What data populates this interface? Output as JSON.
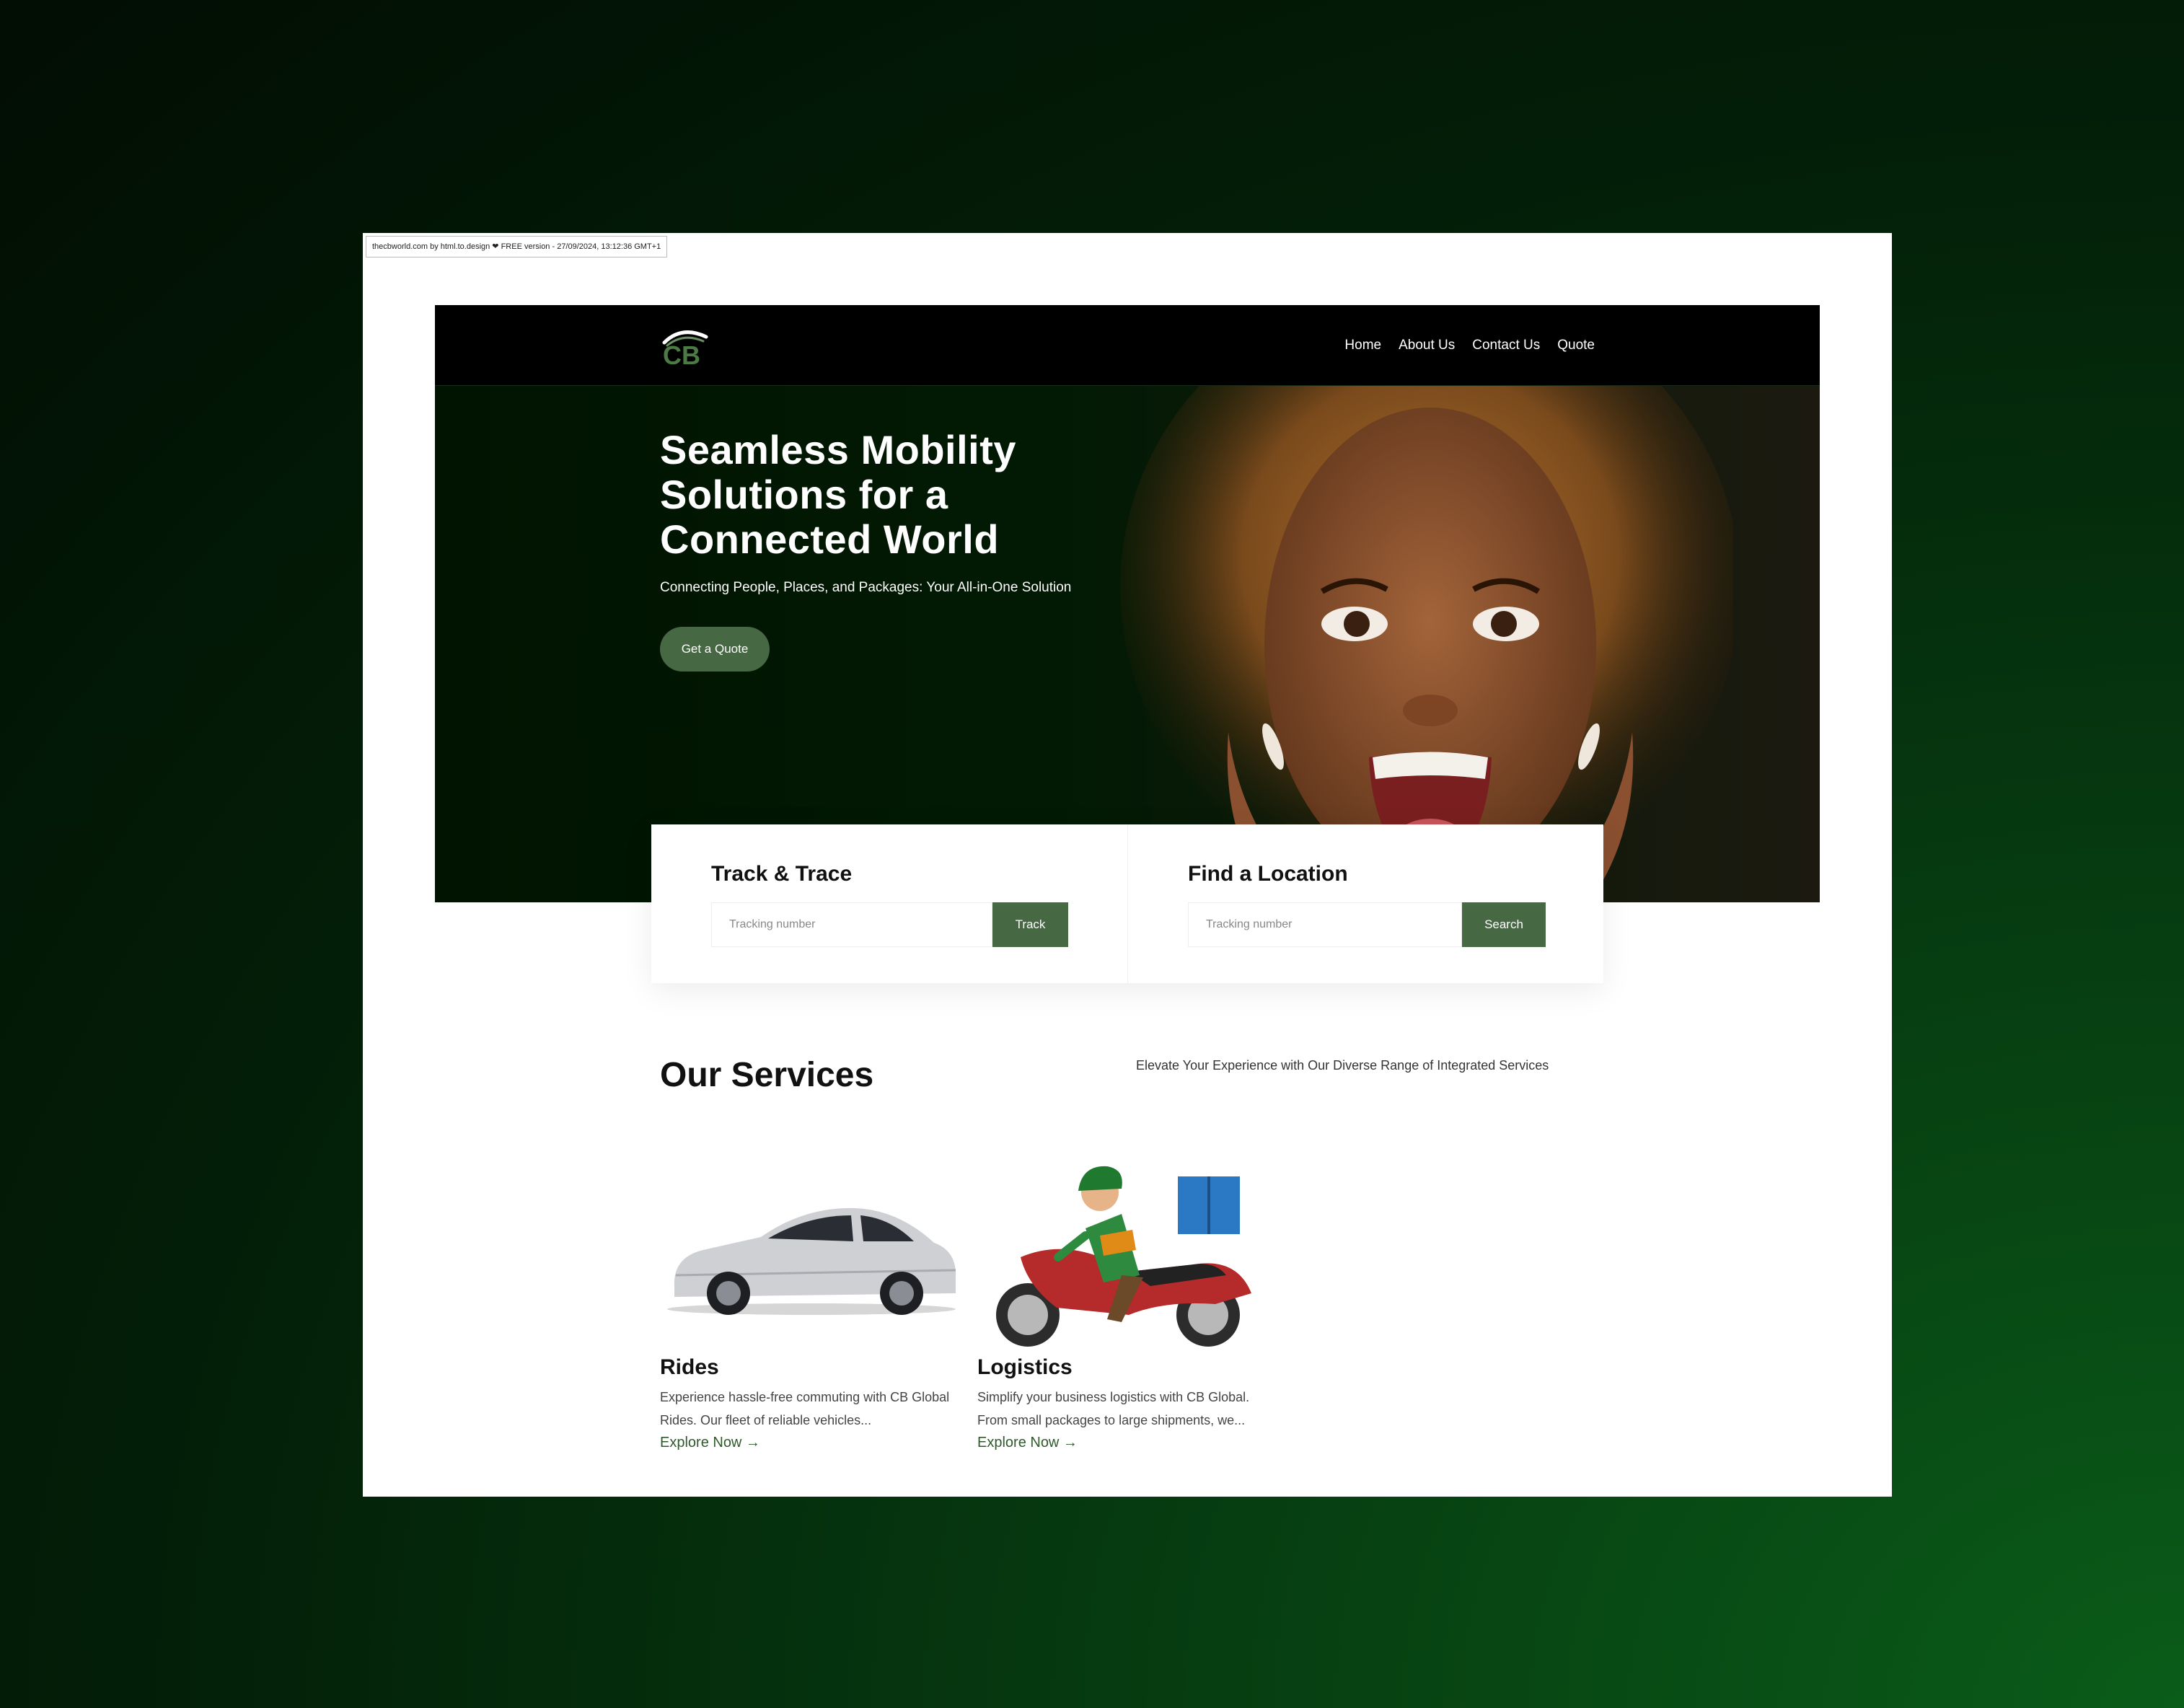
{
  "banner": {
    "text": "thecbworld.com by html.to.design ❤ FREE version - 27/09/2024, 13:12:36 GMT+1"
  },
  "nav": {
    "logo_text": "CB",
    "links": [
      "Home",
      "About Us",
      "Contact Us",
      "Quote"
    ]
  },
  "hero": {
    "title_lines": [
      "Seamless Mobility",
      "Solutions for a",
      "Connected World"
    ],
    "subtitle": "Connecting People, Places, and Packages: Your All-in-One Solution",
    "cta_label": "Get a Quote"
  },
  "track": {
    "title": "Track & Trace",
    "placeholder": "Tracking number",
    "button": "Track"
  },
  "locate": {
    "title": "Find a Location",
    "placeholder": "Tracking number",
    "button": "Search"
  },
  "services": {
    "title": "Our Services",
    "subtitle": "Elevate Your Experience with Our Diverse Range of Integrated Services",
    "cards": [
      {
        "title": "Rides",
        "text": "Experience hassle-free commuting with CB Global Rides. Our fleet of reliable vehicles...",
        "link": "Explore Now →"
      },
      {
        "title": "Logistics",
        "text": "Simplify your business logistics with CB Global. From small packages to large shipments, we...",
        "link": "Explore Now →"
      }
    ]
  },
  "colors": {
    "accent": "#466843",
    "nav_background": "#000000",
    "hero_background": "#011401",
    "link_green": "#2f5a2c"
  }
}
